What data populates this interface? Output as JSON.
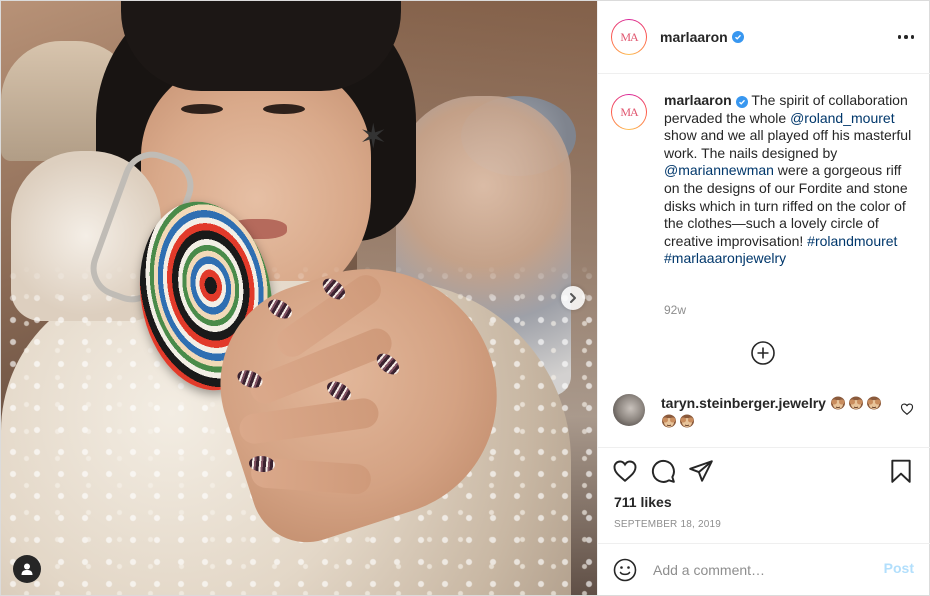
{
  "post": {
    "username": "marlaaron",
    "avatar_initials": "MA",
    "verified": true,
    "caption_parts": [
      {
        "text": "The spirit of collaboration pervaded the whole ",
        "link": false
      },
      {
        "text": "@roland_mouret",
        "link": true
      },
      {
        "text": " show and we all played off his masterful work. The nails designed by ",
        "link": false
      },
      {
        "text": "@mariannewman",
        "link": true
      },
      {
        "text": " were a gorgeous riff on the designs of our Fordite and stone disks which in turn riffed on the color of the clothes—such a lovely circle of creative improvisation! ",
        "link": false
      },
      {
        "text": "#rolandmouret",
        "link": true
      },
      {
        "text": " ",
        "link": false
      },
      {
        "text": "#marlaaaronjewelry",
        "link": true
      }
    ],
    "time_ago": "92w",
    "likes": "711 likes",
    "date": "SEPTEMBER 18, 2019"
  },
  "comment": {
    "username": "taryn.steinberger.jewelry",
    "emoji_count": 5,
    "emoji_name": "see-no-evil-monkey"
  },
  "add_comment": {
    "placeholder": "Add a comment…",
    "post_label": "Post"
  },
  "colors": {
    "link": "#00376b",
    "verified": "#3897f0",
    "post_disabled": "#b2dffc",
    "meta_gray": "#8e8e8e"
  },
  "icons": [
    "more-options-icon",
    "verified-badge-icon",
    "plus-circle-icon",
    "heart-icon",
    "comment-icon",
    "share-icon",
    "bookmark-icon",
    "smiley-icon",
    "next-arrow-icon",
    "user-tag-icon"
  ]
}
